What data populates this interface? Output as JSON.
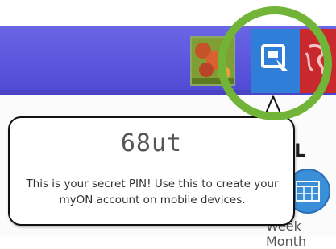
{
  "toolbar": {
    "background_color": "#5a54dc",
    "avatar": {
      "icon": "profile-photo"
    },
    "pin_button": {
      "icon": "login-pin-icon",
      "color": "#2f7fd9"
    },
    "red_button": {
      "icon": "red-swirl-icon",
      "color": "#c9282d"
    }
  },
  "highlight": {
    "shape": "circle",
    "color": "#71b437"
  },
  "tooltip": {
    "pin": "68ut",
    "message": "This is your secret PIN! Use this to create your myON account on mobile devices."
  },
  "background_content": {
    "level_text": "0L",
    "calendar_icon": "calendar-icon",
    "period_label": "Week    Month"
  }
}
